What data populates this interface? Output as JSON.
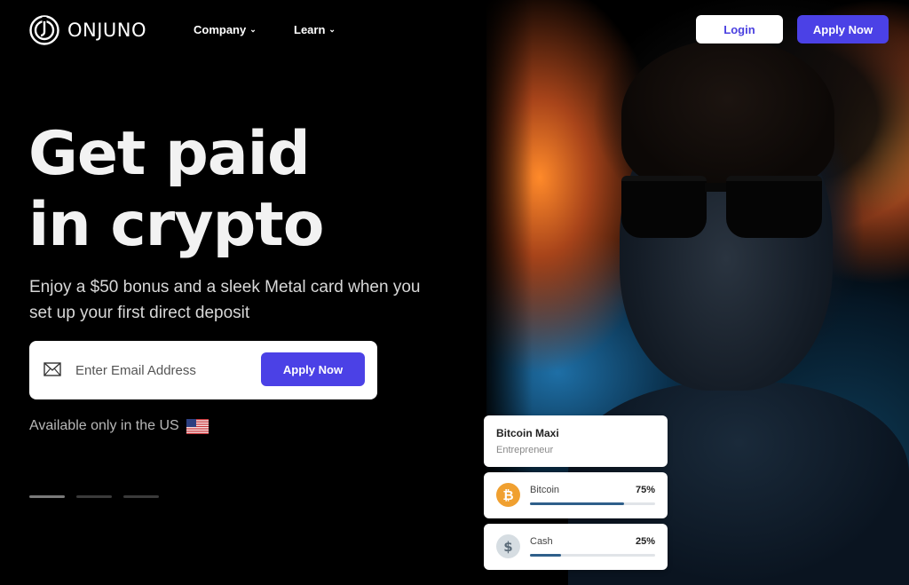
{
  "brand": {
    "name": "ONJUNO"
  },
  "nav": {
    "items": [
      {
        "label": "Company"
      },
      {
        "label": "Learn"
      }
    ],
    "login_label": "Login",
    "apply_label": "Apply Now"
  },
  "hero": {
    "headline_line1": "Get paid",
    "headline_line2": "in crypto",
    "subtext": "Enjoy a $50 bonus and a sleek Metal card when you set up your first direct deposit",
    "email_placeholder": "Enter Email Address",
    "form_button_label": "Apply Now",
    "availability": "Available only in the US",
    "slide_count": 3,
    "active_slide": 1
  },
  "profile_card": {
    "name": "Bitcoin Maxi",
    "role": "Entrepreneur"
  },
  "assets": [
    {
      "name": "Bitcoin",
      "percent_label": "75%",
      "percent": 75,
      "icon": "bitcoin-icon",
      "color": "#f0a030"
    },
    {
      "name": "Cash",
      "percent_label": "25%",
      "percent": 25,
      "icon": "dollar-icon",
      "color": "#d6dde2"
    }
  ],
  "colors": {
    "accent": "#4b41e6",
    "background": "#000000",
    "progress": "#2f5f8a"
  }
}
